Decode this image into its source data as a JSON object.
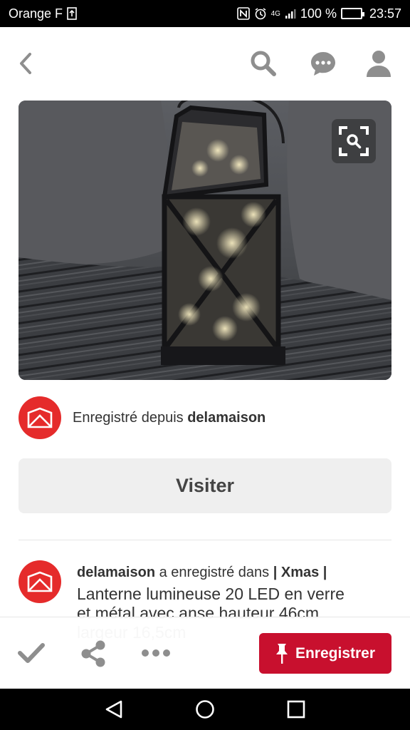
{
  "status_bar": {
    "carrier": "Orange F",
    "battery_percent": "100 %",
    "network": "4G",
    "time": "23:57"
  },
  "icons": {
    "back": "chevron-left-icon",
    "search": "search-icon",
    "messages": "chat-bubble-icon",
    "profile": "user-icon",
    "visual_search": "visual-search-icon",
    "done": "checkmark-icon",
    "share": "share-icon",
    "more": "more-dots-icon",
    "pin": "pushpin-icon"
  },
  "colors": {
    "accent_red": "#c8102e",
    "avatar_red": "#e52b2b",
    "icon_gray": "#8e8e8e"
  },
  "source": {
    "prefix": "Enregistré depuis",
    "site": "delamaison"
  },
  "visit_button": "Visiter",
  "pin_info": {
    "user": "delamaison",
    "action": "a enregistré dans",
    "board": "| Xmas |",
    "description": "Lanterne lumineuse 20 LED en verre et métal avec anse hauteur 46cm largeur 16,5cm"
  },
  "actions": {
    "save_label": "Enregistrer"
  }
}
